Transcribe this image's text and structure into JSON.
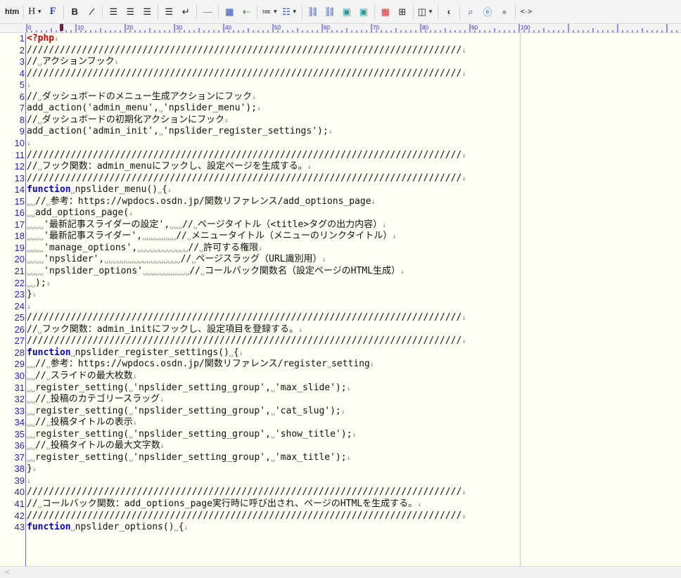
{
  "toolbar": {
    "htm_label": "htm",
    "heading_label": "H",
    "font_label": "F",
    "bold_label": "B",
    "italic_label": "I",
    "more_label": "<·>"
  },
  "ruler": {
    "labels": [
      "0",
      "10",
      "20",
      "30",
      "40",
      "50",
      "60",
      "70",
      "80",
      "90",
      "100"
    ]
  },
  "editor": {
    "lines": [
      {
        "n": "1",
        "segs": [
          {
            "t": "<?php",
            "c": "php"
          },
          {
            "t": "↓",
            "c": "mark"
          }
        ]
      },
      {
        "n": "2",
        "segs": [
          {
            "t": "///////////////////////////////////////////////////////////////////////////////",
            "c": ""
          },
          {
            "t": "↓",
            "c": "mark"
          }
        ]
      },
      {
        "n": "3",
        "segs": [
          {
            "t": "//",
            "c": ""
          },
          {
            "t": "␣",
            "c": "mark"
          },
          {
            "t": "アクションフック",
            "c": ""
          },
          {
            "t": "↓",
            "c": "mark"
          }
        ]
      },
      {
        "n": "4",
        "segs": [
          {
            "t": "///////////////////////////////////////////////////////////////////////////////",
            "c": ""
          },
          {
            "t": "↓",
            "c": "mark"
          }
        ]
      },
      {
        "n": "5",
        "segs": [
          {
            "t": "↓",
            "c": "mark"
          }
        ]
      },
      {
        "n": "6",
        "segs": [
          {
            "t": "//",
            "c": ""
          },
          {
            "t": "␣",
            "c": "mark"
          },
          {
            "t": "ダッシュボードのメニュー生成アクションにフック",
            "c": ""
          },
          {
            "t": "↓",
            "c": "mark"
          }
        ]
      },
      {
        "n": "7",
        "segs": [
          {
            "t": "add_action('admin_menu',",
            "c": ""
          },
          {
            "t": "␣",
            "c": "mark"
          },
          {
            "t": "'npslider_menu');",
            "c": ""
          },
          {
            "t": "↓",
            "c": "mark"
          }
        ]
      },
      {
        "n": "8",
        "segs": [
          {
            "t": "//",
            "c": ""
          },
          {
            "t": "␣",
            "c": "mark"
          },
          {
            "t": "ダッシュボードの初期化アクションにフック",
            "c": ""
          },
          {
            "t": "↓",
            "c": "mark"
          }
        ]
      },
      {
        "n": "9",
        "segs": [
          {
            "t": "add_action('admin_init',",
            "c": ""
          },
          {
            "t": "␣",
            "c": "mark"
          },
          {
            "t": "'npslider_register_settings');",
            "c": ""
          },
          {
            "t": "↓",
            "c": "mark"
          }
        ]
      },
      {
        "n": "10",
        "segs": [
          {
            "t": "↓",
            "c": "mark"
          }
        ]
      },
      {
        "n": "11",
        "segs": [
          {
            "t": "///////////////////////////////////////////////////////////////////////////////",
            "c": ""
          },
          {
            "t": "↓",
            "c": "mark"
          }
        ]
      },
      {
        "n": "12",
        "segs": [
          {
            "t": "//",
            "c": ""
          },
          {
            "t": "␣",
            "c": "mark"
          },
          {
            "t": "フック関数：admin_menuにフックし、設定ページを生成する。",
            "c": ""
          },
          {
            "t": "↓",
            "c": "mark"
          }
        ]
      },
      {
        "n": "13",
        "segs": [
          {
            "t": "///////////////////////////////////////////////////////////////////////////////",
            "c": ""
          },
          {
            "t": "↓",
            "c": "mark"
          }
        ]
      },
      {
        "n": "14",
        "segs": [
          {
            "t": "function",
            "c": "kw"
          },
          {
            "t": "␣",
            "c": "mark"
          },
          {
            "t": "npslider_menu()",
            "c": ""
          },
          {
            "t": "␣",
            "c": "mark"
          },
          {
            "t": "{",
            "c": ""
          },
          {
            "t": "↓",
            "c": "mark"
          }
        ]
      },
      {
        "n": "15",
        "segs": [
          {
            "t": "␣␣",
            "c": "mark"
          },
          {
            "t": "//",
            "c": ""
          },
          {
            "t": "␣",
            "c": "mark"
          },
          {
            "t": "参考：https://wpdocs.osdn.jp/関数リファレンス/add_options_page",
            "c": ""
          },
          {
            "t": "↓",
            "c": "mark"
          }
        ]
      },
      {
        "n": "16",
        "segs": [
          {
            "t": "␣␣",
            "c": "mark"
          },
          {
            "t": "add_options_page(",
            "c": ""
          },
          {
            "t": "↓",
            "c": "mark"
          }
        ]
      },
      {
        "n": "17",
        "segs": [
          {
            "t": "␣␣␣␣",
            "c": "mark"
          },
          {
            "t": "'最新記事スライダーの設定',",
            "c": ""
          },
          {
            "t": "␣␣␣",
            "c": "mark"
          },
          {
            "t": "//",
            "c": ""
          },
          {
            "t": "␣",
            "c": "mark"
          },
          {
            "t": "ページタイトル（<title>タグの出力内容）",
            "c": ""
          },
          {
            "t": "↓",
            "c": "mark"
          }
        ]
      },
      {
        "n": "18",
        "segs": [
          {
            "t": "␣␣␣␣",
            "c": "mark"
          },
          {
            "t": "'最新記事スライダー',",
            "c": ""
          },
          {
            "t": "␣␣␣␣␣␣␣␣",
            "c": "mark"
          },
          {
            "t": "//",
            "c": ""
          },
          {
            "t": "␣",
            "c": "mark"
          },
          {
            "t": "メニュータイトル（メニューのリンクタイトル）",
            "c": ""
          },
          {
            "t": "↓",
            "c": "mark"
          }
        ]
      },
      {
        "n": "19",
        "segs": [
          {
            "t": "␣␣␣␣",
            "c": "mark"
          },
          {
            "t": "'manage_options',",
            "c": ""
          },
          {
            "t": "␣␣␣␣␣␣␣␣␣␣␣␣",
            "c": "mark"
          },
          {
            "t": "//",
            "c": ""
          },
          {
            "t": "␣",
            "c": "mark"
          },
          {
            "t": "許可する権限",
            "c": ""
          },
          {
            "t": "↓",
            "c": "mark"
          }
        ]
      },
      {
        "n": "20",
        "segs": [
          {
            "t": "␣␣␣␣",
            "c": "mark"
          },
          {
            "t": "'npslider',",
            "c": ""
          },
          {
            "t": "␣␣␣␣␣␣␣␣␣␣␣␣␣␣␣␣␣␣",
            "c": "mark"
          },
          {
            "t": "//",
            "c": ""
          },
          {
            "t": "␣",
            "c": "mark"
          },
          {
            "t": "ページスラッグ（URL識別用）",
            "c": ""
          },
          {
            "t": "↓",
            "c": "mark"
          }
        ]
      },
      {
        "n": "21",
        "segs": [
          {
            "t": "␣␣␣␣",
            "c": "mark"
          },
          {
            "t": "'npslider_options'",
            "c": ""
          },
          {
            "t": "␣␣␣␣␣␣␣␣␣␣␣",
            "c": "mark"
          },
          {
            "t": "//",
            "c": ""
          },
          {
            "t": "␣",
            "c": "mark"
          },
          {
            "t": "コールバック関数名（設定ページのHTML生成）",
            "c": ""
          },
          {
            "t": "↓",
            "c": "mark"
          }
        ]
      },
      {
        "n": "22",
        "segs": [
          {
            "t": "␣␣",
            "c": "mark"
          },
          {
            "t": ");",
            "c": ""
          },
          {
            "t": "↓",
            "c": "mark"
          }
        ]
      },
      {
        "n": "23",
        "segs": [
          {
            "t": "}",
            "c": ""
          },
          {
            "t": "↓",
            "c": "mark"
          }
        ]
      },
      {
        "n": "24",
        "segs": [
          {
            "t": "↓",
            "c": "mark"
          }
        ]
      },
      {
        "n": "25",
        "segs": [
          {
            "t": "///////////////////////////////////////////////////////////////////////////////",
            "c": ""
          },
          {
            "t": "↓",
            "c": "mark"
          }
        ]
      },
      {
        "n": "26",
        "segs": [
          {
            "t": "//",
            "c": ""
          },
          {
            "t": "␣",
            "c": "mark"
          },
          {
            "t": "フック関数：admin_initにフックし、設定項目を登録する。",
            "c": ""
          },
          {
            "t": "↓",
            "c": "mark"
          }
        ]
      },
      {
        "n": "27",
        "segs": [
          {
            "t": "///////////////////////////////////////////////////////////////////////////////",
            "c": ""
          },
          {
            "t": "↓",
            "c": "mark"
          }
        ]
      },
      {
        "n": "28",
        "segs": [
          {
            "t": "function",
            "c": "kw"
          },
          {
            "t": "␣",
            "c": "mark"
          },
          {
            "t": "npslider_register_settings()",
            "c": ""
          },
          {
            "t": "␣",
            "c": "mark"
          },
          {
            "t": "{",
            "c": ""
          },
          {
            "t": "↓",
            "c": "mark"
          }
        ]
      },
      {
        "n": "29",
        "segs": [
          {
            "t": "␣␣",
            "c": "mark"
          },
          {
            "t": "//",
            "c": ""
          },
          {
            "t": "␣",
            "c": "mark"
          },
          {
            "t": "参考：https://wpdocs.osdn.jp/関数リファレンス/register",
            "c": ""
          },
          {
            "t": "␣",
            "c": "mark"
          },
          {
            "t": "setting",
            "c": ""
          },
          {
            "t": "↓",
            "c": "mark"
          }
        ]
      },
      {
        "n": "30",
        "segs": [
          {
            "t": "␣␣",
            "c": "mark"
          },
          {
            "t": "//",
            "c": ""
          },
          {
            "t": "␣",
            "c": "mark"
          },
          {
            "t": "スライドの最大枚数",
            "c": ""
          },
          {
            "t": "↓",
            "c": "mark"
          }
        ]
      },
      {
        "n": "31",
        "segs": [
          {
            "t": "␣␣",
            "c": "mark"
          },
          {
            "t": "register_setting(",
            "c": ""
          },
          {
            "t": "␣",
            "c": "mark"
          },
          {
            "t": "'npslider_setting_group',",
            "c": ""
          },
          {
            "t": "␣",
            "c": "mark"
          },
          {
            "t": "'max_slide');",
            "c": ""
          },
          {
            "t": "↓",
            "c": "mark"
          }
        ]
      },
      {
        "n": "32",
        "segs": [
          {
            "t": "␣␣",
            "c": "mark"
          },
          {
            "t": "//",
            "c": ""
          },
          {
            "t": "␣",
            "c": "mark"
          },
          {
            "t": "投稿のカテゴリースラッグ",
            "c": ""
          },
          {
            "t": "↓",
            "c": "mark"
          }
        ]
      },
      {
        "n": "33",
        "segs": [
          {
            "t": "␣␣",
            "c": "mark"
          },
          {
            "t": "register_setting(",
            "c": ""
          },
          {
            "t": "␣",
            "c": "mark"
          },
          {
            "t": "'npslider_setting_group',",
            "c": ""
          },
          {
            "t": "␣",
            "c": "mark"
          },
          {
            "t": "'cat_slug');",
            "c": ""
          },
          {
            "t": "↓",
            "c": "mark"
          }
        ]
      },
      {
        "n": "34",
        "segs": [
          {
            "t": "␣␣",
            "c": "mark"
          },
          {
            "t": "//",
            "c": ""
          },
          {
            "t": "␣",
            "c": "mark"
          },
          {
            "t": "投稿タイトルの表示",
            "c": ""
          },
          {
            "t": "↓",
            "c": "mark"
          }
        ]
      },
      {
        "n": "35",
        "segs": [
          {
            "t": "␣␣",
            "c": "mark"
          },
          {
            "t": "register_setting(",
            "c": ""
          },
          {
            "t": "␣",
            "c": "mark"
          },
          {
            "t": "'npslider_setting_group',",
            "c": ""
          },
          {
            "t": "␣",
            "c": "mark"
          },
          {
            "t": "'show_title');",
            "c": ""
          },
          {
            "t": "↓",
            "c": "mark"
          }
        ]
      },
      {
        "n": "36",
        "segs": [
          {
            "t": "␣␣",
            "c": "mark"
          },
          {
            "t": "//",
            "c": ""
          },
          {
            "t": "␣",
            "c": "mark"
          },
          {
            "t": "投稿タイトルの最大文字数",
            "c": ""
          },
          {
            "t": "↓",
            "c": "mark"
          }
        ]
      },
      {
        "n": "37",
        "segs": [
          {
            "t": "␣␣",
            "c": "mark"
          },
          {
            "t": "register_setting(",
            "c": ""
          },
          {
            "t": "␣",
            "c": "mark"
          },
          {
            "t": "'npslider_setting_group',",
            "c": ""
          },
          {
            "t": "␣",
            "c": "mark"
          },
          {
            "t": "'max_title');",
            "c": ""
          },
          {
            "t": "↓",
            "c": "mark"
          }
        ]
      },
      {
        "n": "38",
        "segs": [
          {
            "t": "}",
            "c": ""
          },
          {
            "t": "↓",
            "c": "mark"
          }
        ]
      },
      {
        "n": "39",
        "segs": [
          {
            "t": "↓",
            "c": "mark"
          }
        ]
      },
      {
        "n": "40",
        "segs": [
          {
            "t": "///////////////////////////////////////////////////////////////////////////////",
            "c": ""
          },
          {
            "t": "↓",
            "c": "mark"
          }
        ]
      },
      {
        "n": "41",
        "segs": [
          {
            "t": "//",
            "c": ""
          },
          {
            "t": "␣",
            "c": "mark"
          },
          {
            "t": "コールバック関数：add_options_page実行時に呼び出され、ページのHTMLを生成する。",
            "c": ""
          },
          {
            "t": "↓",
            "c": "mark"
          }
        ]
      },
      {
        "n": "42",
        "segs": [
          {
            "t": "///////////////////////////////////////////////////////////////////////////////",
            "c": ""
          },
          {
            "t": "↓",
            "c": "mark"
          }
        ]
      },
      {
        "n": "43",
        "segs": [
          {
            "t": "function",
            "c": "kw"
          },
          {
            "t": "␣",
            "c": "mark"
          },
          {
            "t": "npslider_options()",
            "c": ""
          },
          {
            "t": "␣",
            "c": "mark"
          },
          {
            "t": "{",
            "c": ""
          },
          {
            "t": "↓",
            "c": "mark"
          }
        ]
      }
    ]
  },
  "colors": {
    "background": "#fffff4",
    "line_number": "#1b1bff",
    "keyword": "#0000c8",
    "php_tag": "#d40000"
  }
}
